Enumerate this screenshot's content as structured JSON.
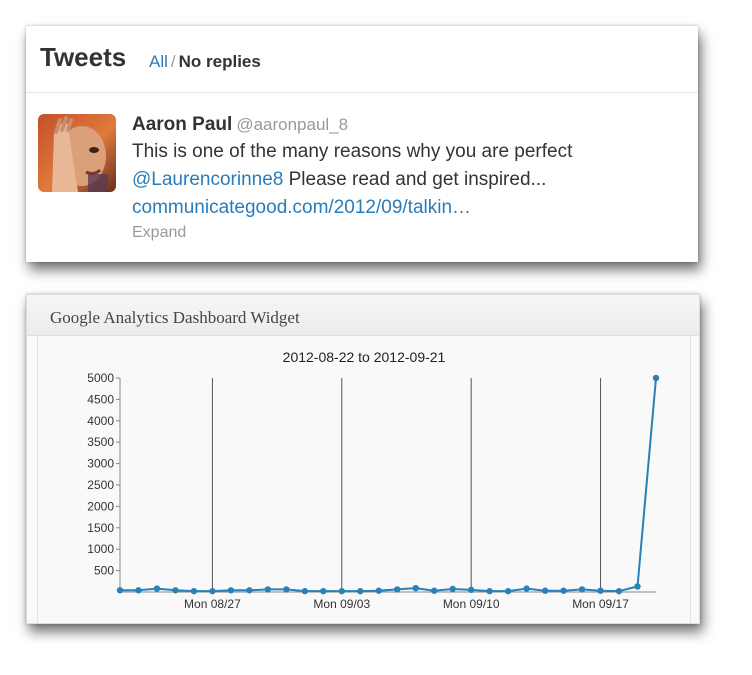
{
  "tweets": {
    "title": "Tweets",
    "filter_all": "All",
    "filter_separator": "/",
    "filter_noreplies": "No replies",
    "items": [
      {
        "author": "Aaron Paul",
        "handle": "@aaronpaul_8",
        "line1": "This is one of the many reasons why you are perfect",
        "mention": "@Laurencorinne8",
        "line2_rest": " Please read and get inspired...",
        "link": "communicategood.com/2012/09/talkin…",
        "expand": "Expand"
      }
    ]
  },
  "widget": {
    "title": "Google Analytics Dashboard Widget"
  },
  "chart_data": {
    "type": "line",
    "title": "2012-08-22 to 2012-09-21",
    "xlabel": "",
    "ylabel": "",
    "ylim": [
      0,
      5000
    ],
    "yticks": [
      500,
      1000,
      1500,
      2000,
      2500,
      3000,
      3500,
      4000,
      4500,
      5000
    ],
    "x": [
      "2012-08-22",
      "2012-08-23",
      "2012-08-24",
      "2012-08-25",
      "2012-08-26",
      "2012-08-27",
      "2012-08-28",
      "2012-08-29",
      "2012-08-30",
      "2012-08-31",
      "2012-09-01",
      "2012-09-02",
      "2012-09-03",
      "2012-09-04",
      "2012-09-05",
      "2012-09-06",
      "2012-09-07",
      "2012-09-08",
      "2012-09-09",
      "2012-09-10",
      "2012-09-11",
      "2012-09-12",
      "2012-09-13",
      "2012-09-14",
      "2012-09-15",
      "2012-09-16",
      "2012-09-17",
      "2012-09-18",
      "2012-09-19",
      "2012-09-20",
      "2012-09-21"
    ],
    "x_tick_labels": [
      {
        "index": 5,
        "label": "Mon 08/27"
      },
      {
        "index": 12,
        "label": "Mon 09/03"
      },
      {
        "index": 19,
        "label": "Mon 09/10"
      },
      {
        "index": 26,
        "label": "Mon 09/17"
      }
    ],
    "series": [
      {
        "color": "#2a80b9",
        "values": [
          40,
          40,
          80,
          40,
          20,
          20,
          40,
          40,
          60,
          60,
          20,
          20,
          20,
          20,
          30,
          60,
          90,
          30,
          70,
          50,
          20,
          20,
          80,
          30,
          30,
          60,
          30,
          20,
          130,
          5000
        ]
      }
    ],
    "grid": "vertical-at-mondays",
    "legend": "none"
  }
}
